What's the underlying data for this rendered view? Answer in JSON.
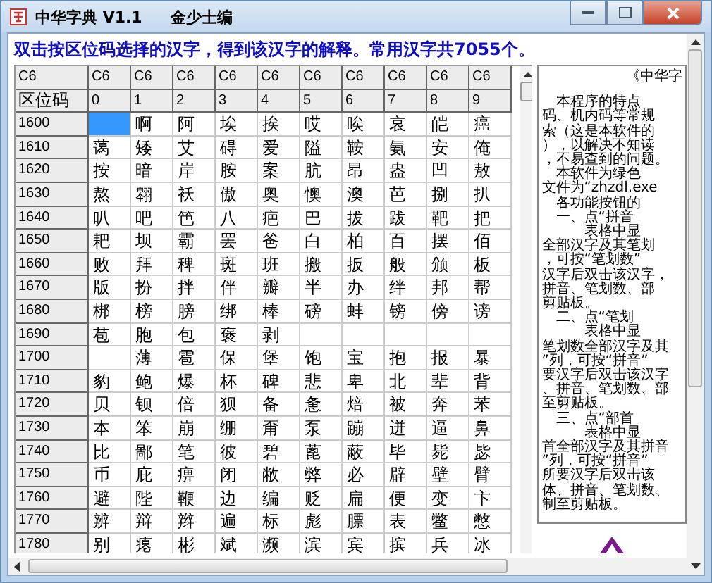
{
  "window": {
    "title": "中华字典 V1.1",
    "author": "金少士编"
  },
  "instruction": "双击按区位码选择的汉字，得到该汉字的解释。常用汉字共7055个。",
  "grid": {
    "corner": "C6",
    "top_row": [
      "C6",
      "C6",
      "C6",
      "C6",
      "C6",
      "C6",
      "C6",
      "C6",
      "C6",
      "C6"
    ],
    "row_header_title": "区位码",
    "columns": [
      "0",
      "1",
      "2",
      "3",
      "4",
      "5",
      "6",
      "7",
      "8",
      "9"
    ],
    "rows": [
      {
        "code": "1600",
        "selected": true,
        "cells": [
          null,
          "啊",
          "阿",
          "埃",
          "挨",
          "哎",
          "唉",
          "哀",
          "皑",
          "癌"
        ]
      },
      {
        "code": "1610",
        "selected": false,
        "cells": [
          "蔼",
          "矮",
          "艾",
          "碍",
          "爱",
          "隘",
          "鞍",
          "氨",
          "安",
          "俺"
        ]
      },
      {
        "code": "1620",
        "selected": false,
        "cells": [
          "按",
          "暗",
          "岸",
          "胺",
          "案",
          "肮",
          "昂",
          "盎",
          "凹",
          "敖"
        ]
      },
      {
        "code": "1630",
        "selected": false,
        "cells": [
          "熬",
          "翱",
          "袄",
          "傲",
          "奥",
          "懊",
          "澳",
          "芭",
          "捌",
          "扒"
        ]
      },
      {
        "code": "1640",
        "selected": false,
        "cells": [
          "叭",
          "吧",
          "笆",
          "八",
          "疤",
          "巴",
          "拔",
          "跋",
          "靶",
          "把"
        ]
      },
      {
        "code": "1650",
        "selected": false,
        "cells": [
          "耙",
          "坝",
          "霸",
          "罢",
          "爸",
          "白",
          "柏",
          "百",
          "摆",
          "佰"
        ]
      },
      {
        "code": "1660",
        "selected": false,
        "cells": [
          "败",
          "拜",
          "稗",
          "斑",
          "班",
          "搬",
          "扳",
          "般",
          "颁",
          "板"
        ]
      },
      {
        "code": "1670",
        "selected": false,
        "cells": [
          "版",
          "扮",
          "拌",
          "伴",
          "瓣",
          "半",
          "办",
          "绊",
          "邦",
          "帮"
        ]
      },
      {
        "code": "1680",
        "selected": false,
        "cells": [
          "梆",
          "榜",
          "膀",
          "绑",
          "棒",
          "磅",
          "蚌",
          "镑",
          "傍",
          "谤"
        ]
      },
      {
        "code": "1690",
        "selected": false,
        "cells": [
          "苞",
          "胞",
          "包",
          "褒",
          "剥",
          null,
          null,
          null,
          null,
          null
        ]
      },
      {
        "code": "1700",
        "selected": false,
        "cells": [
          null,
          "薄",
          "雹",
          "保",
          "堡",
          "饱",
          "宝",
          "抱",
          "报",
          "暴"
        ]
      },
      {
        "code": "1710",
        "selected": false,
        "cells": [
          "豹",
          "鲍",
          "爆",
          "杯",
          "碑",
          "悲",
          "卑",
          "北",
          "辈",
          "背"
        ]
      },
      {
        "code": "1720",
        "selected": false,
        "cells": [
          "贝",
          "钡",
          "倍",
          "狈",
          "备",
          "惫",
          "焙",
          "被",
          "奔",
          "苯"
        ]
      },
      {
        "code": "1730",
        "selected": false,
        "cells": [
          "本",
          "笨",
          "崩",
          "绷",
          "甭",
          "泵",
          "蹦",
          "迸",
          "逼",
          "鼻"
        ]
      },
      {
        "code": "1740",
        "selected": false,
        "cells": [
          "比",
          "鄙",
          "笔",
          "彼",
          "碧",
          "蓖",
          "蔽",
          "毕",
          "毙",
          "毖"
        ]
      },
      {
        "code": "1750",
        "selected": false,
        "cells": [
          "币",
          "庇",
          "痹",
          "闭",
          "敝",
          "弊",
          "必",
          "辟",
          "壁",
          "臂"
        ]
      },
      {
        "code": "1760",
        "selected": false,
        "cells": [
          "避",
          "陛",
          "鞭",
          "边",
          "编",
          "贬",
          "扁",
          "便",
          "变",
          "卞"
        ]
      },
      {
        "code": "1770",
        "selected": false,
        "cells": [
          "辨",
          "辩",
          "辫",
          "遍",
          "标",
          "彪",
          "膘",
          "表",
          "鳖",
          "憋"
        ]
      },
      {
        "code": "1780",
        "selected": false,
        "cells": [
          "别",
          "瘪",
          "彬",
          "斌",
          "濒",
          "滨",
          "宾",
          "摈",
          "兵",
          "冰"
        ]
      }
    ]
  },
  "description_lines": [
    "《中华字",
    "　本程序的特点",
    "码、机内码等常规",
    "索（这是本软件的",
    "），以解决不知读",
    "，不易查到的问题。",
    "　本软件为绿色",
    "文件为“zhzdl.exe",
    "　各功能按钮的",
    "　一、点“拼音",
    "　　　表格中显",
    "全部汉字及其笔划",
    "，可按“笔划数”",
    "汉字后双击该汉字，",
    "拼音、笔划数、部",
    "剪贴板。",
    "　二、点“笔划",
    "　　　表格中显",
    "笔划数全部汉字及其",
    "”列，可按“拼音”",
    "要汉字后双击该汉字",
    "、拼音、笔划数、部",
    "至剪贴板。",
    "　三、点“部首",
    "　　　表格中显",
    "首全部汉字及其拼音",
    "”列，可按“拼音”",
    "所要汉字后双击该",
    "体、拼音、笔划数、",
    "制至剪贴板。"
  ]
}
